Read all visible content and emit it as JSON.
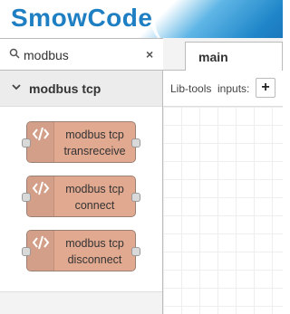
{
  "app": {
    "logo_text": "SmowCode"
  },
  "palette": {
    "search": {
      "value": "modbus",
      "clear_label": "×"
    },
    "category": {
      "label": "modbus tcp"
    },
    "nodes": [
      {
        "line1": "modbus tcp",
        "line2": "transreceive",
        "color": "#e2a991"
      },
      {
        "line1": "modbus tcp",
        "line2": "connect",
        "color": "#e2a991"
      },
      {
        "line1": "modbus tcp",
        "line2": "disconnect",
        "color": "#e2a991"
      }
    ]
  },
  "workspace": {
    "tab": {
      "label": "main"
    },
    "toolbar": {
      "lib_tools_label": "Lib-tools",
      "inputs_label": "inputs:",
      "add_label": "+"
    }
  },
  "colors": {
    "accent": "#1e7fc3",
    "node": "#e2a991"
  }
}
